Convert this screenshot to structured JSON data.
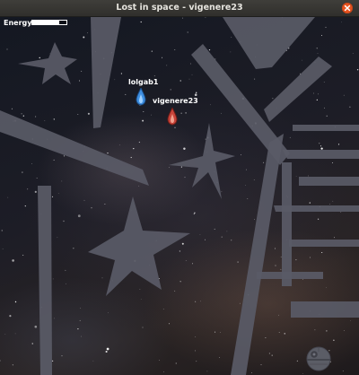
{
  "window": {
    "title": "Lost in space - vigenere23",
    "close_icon": "close-icon"
  },
  "hud": {
    "energy_label": "Energy",
    "energy_level": 0.8
  },
  "players": [
    {
      "name": "lolgab1",
      "color": "#3f8fe0",
      "ship_icon": "blue-ship-icon"
    },
    {
      "name": "vigenere23",
      "color": "#c8443a",
      "ship_icon": "red-ship-icon"
    }
  ],
  "colors": {
    "wall": "#5a5b66",
    "space": "#1a1a22",
    "close_button": "#e95420"
  }
}
